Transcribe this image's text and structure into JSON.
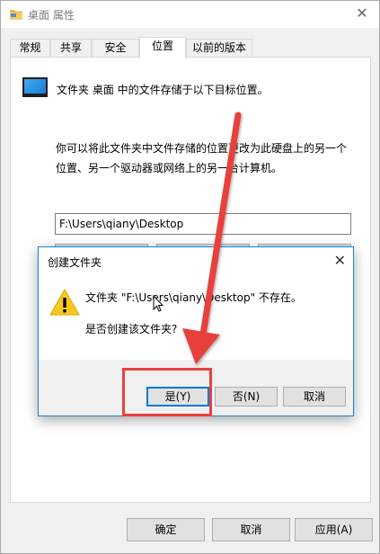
{
  "window": {
    "title": "桌面 属性",
    "close_symbol": "✕"
  },
  "tabs": [
    {
      "label": "常规",
      "active": false
    },
    {
      "label": "共享",
      "active": false
    },
    {
      "label": "安全",
      "active": false
    },
    {
      "label": "位置",
      "active": true
    },
    {
      "label": "以前的版本",
      "active": false
    }
  ],
  "location": {
    "info": "文件夹 桌面 中的文件存储于以下目标位置。",
    "description": "你可以将此文件夹中文件存储的位置更改为此硬盘上的另一个位置、另一个驱动器或网络上的另一台计算机。",
    "path": "F:\\Users\\qiany\\Desktop"
  },
  "footer": {
    "ok": "确定",
    "cancel": "取消",
    "apply": "应用(A)"
  },
  "dialog": {
    "title": "创建文件夹",
    "close_symbol": "✕",
    "message": "文件夹 \"F:\\Users\\qiany\\Desktop\" 不存在。",
    "question": "是否创建该文件夹?",
    "yes": "是(Y)",
    "no": "否(N)",
    "cancel": "取消"
  },
  "colors": {
    "annotation": "#e8413d",
    "focus_border": "#0078d7"
  }
}
